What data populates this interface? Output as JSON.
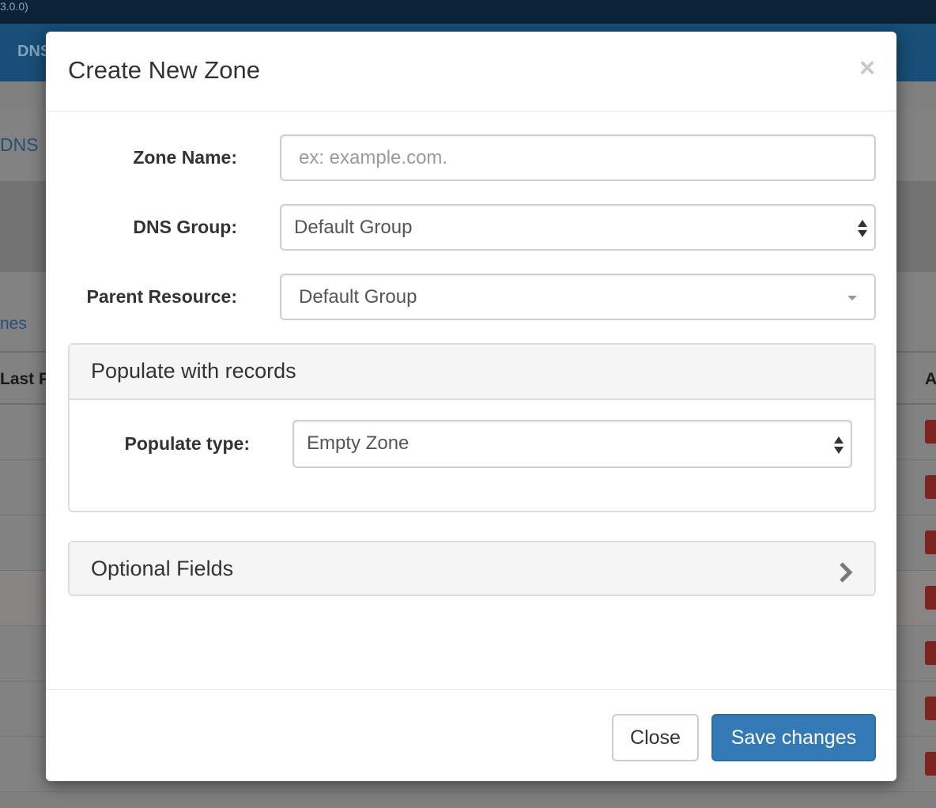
{
  "background": {
    "version_text": "3.0.0)",
    "nav_text": "DNS",
    "breadcrumb_text": "DNS",
    "tab_text": "nes",
    "table_header_left": "Last P",
    "table_header_right": "A"
  },
  "modal": {
    "title": "Create New Zone",
    "close_symbol": "×",
    "zone_name": {
      "label": "Zone Name:",
      "value": "",
      "placeholder": "ex: example.com."
    },
    "dns_group": {
      "label": "DNS Group:",
      "selected": "Default Group"
    },
    "parent_resource": {
      "label": "Parent Resource:",
      "selected": "Default Group"
    },
    "populate_panel": {
      "title": "Populate with records",
      "populate_type": {
        "label": "Populate type:",
        "selected": "Empty Zone"
      }
    },
    "optional_panel": {
      "title": "Optional Fields",
      "expand_icon": "chevron-right-icon"
    },
    "footer": {
      "close_label": "Close",
      "save_label": "Save changes"
    }
  },
  "colors": {
    "primary": "#337ab7",
    "nav_background": "#184e78",
    "danger": "#d9534f"
  }
}
